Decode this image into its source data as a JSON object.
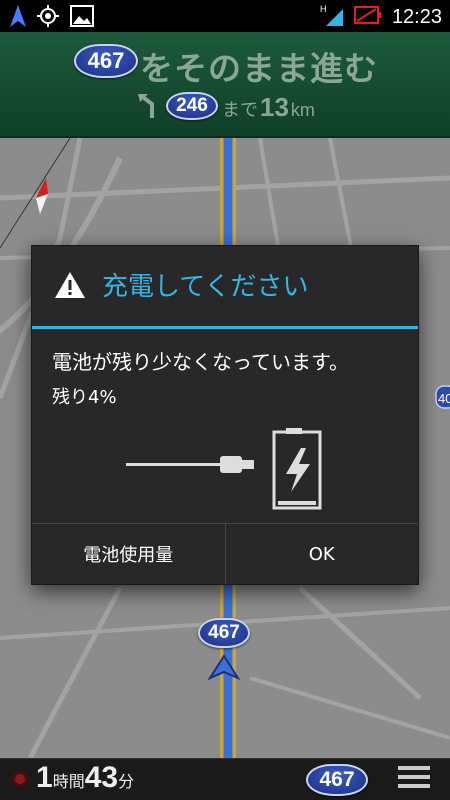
{
  "status_bar": {
    "time": "12:23",
    "network_type": "H",
    "icons": [
      "navigation-arrow-icon",
      "gps-icon",
      "image-icon",
      "signal-icon",
      "battery-low-icon"
    ],
    "colors": {
      "signal": "#33b5e5",
      "battery": "#e02020"
    }
  },
  "nav_header": {
    "route_number": "467",
    "instruction": "をそのまま進む",
    "next_route_number": "246",
    "until_label": "まで",
    "distance_value": "13",
    "distance_unit": "km",
    "turn_icon": "turn-left-arrow-icon"
  },
  "map": {
    "route_shield_label": "467",
    "side_label": "40"
  },
  "dialog": {
    "title": "充電してください",
    "message_line1": "電池が残り少なくなっています。",
    "message_line2": "残り4%",
    "battery_level_percent": 4,
    "buttons": {
      "battery_usage": "電池使用量",
      "ok": "OK"
    },
    "accent_color": "#33b5e5"
  },
  "bottom_bar": {
    "eta_hours": "1",
    "eta_hours_label": "時間",
    "eta_minutes": "43",
    "eta_minutes_label": "分",
    "route_number": "467",
    "menu_icon": "hamburger-menu-icon"
  }
}
